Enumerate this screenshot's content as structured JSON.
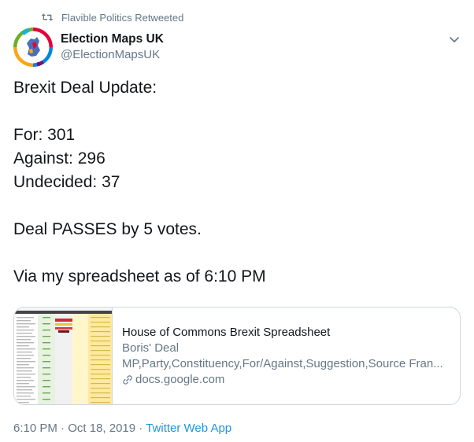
{
  "retweet": {
    "label": "Flavible Politics Retweeted",
    "icon": "retweet-icon"
  },
  "author": {
    "display_name": "Election Maps UK",
    "handle": "@ElectionMapsUK",
    "avatar_icon": "election-maps-logo"
  },
  "tweet": {
    "lines": [
      "Brexit Deal Update:",
      "For: 301",
      "Against: 296",
      "Undecided: 37",
      "Deal PASSES by 5 votes.",
      "Via my spreadsheet as of 6:10 PM"
    ]
  },
  "card": {
    "title": "House of Commons Brexit Spreadsheet",
    "description_line1": "Boris' Deal",
    "description_line2": "MP,Party,Constituency,For/Against,Suggestion,Source Fran...",
    "domain": "docs.google.com",
    "icon": "link-icon"
  },
  "meta": {
    "time": "6:10 PM",
    "separator": " · ",
    "date": "Oct 18, 2019",
    "source": "Twitter Web App"
  },
  "colors": {
    "text": "#14171a",
    "secondary": "#657786",
    "link": "#1b95e0",
    "border": "#ccd6dd"
  }
}
